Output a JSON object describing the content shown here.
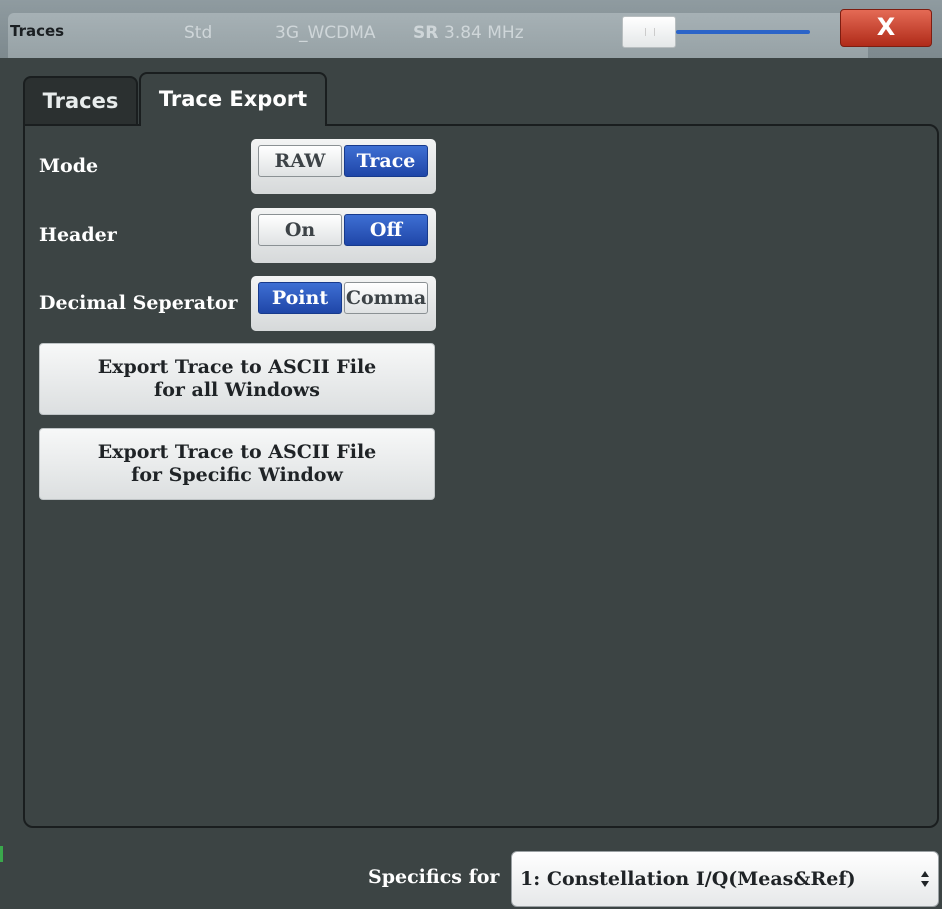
{
  "titlebar": {
    "title": "Traces",
    "std_label": "Std",
    "std_value": "3G_WCDMA",
    "sr_label": "SR",
    "sr_value": "3.84 MHz",
    "close_label": "X"
  },
  "tabs": [
    {
      "label": "Traces",
      "active": false
    },
    {
      "label": "Trace Export",
      "active": true
    }
  ],
  "settings": {
    "mode": {
      "label": "Mode",
      "options": [
        "RAW",
        "Trace"
      ],
      "selected": "Trace"
    },
    "header": {
      "label": "Header",
      "options": [
        "On",
        "Off"
      ],
      "selected": "Off"
    },
    "decimal_separator": {
      "label": "Decimal Seperator",
      "options": [
        "Point",
        "Comma"
      ],
      "selected": "Point"
    }
  },
  "actions": {
    "export_all": {
      "line1": "Export Trace to ASCII File",
      "line2": "for all Windows"
    },
    "export_specific": {
      "line1": "Export Trace to ASCII File",
      "line2": "for Specific Window"
    }
  },
  "footer": {
    "specifics_label": "Specifics for",
    "specifics_value": "1: Constellation I/Q(Meas&Ref)"
  },
  "colors": {
    "background": "#3c4444",
    "accent_blue": "#2c64c8",
    "close_red": "#c9402c"
  }
}
